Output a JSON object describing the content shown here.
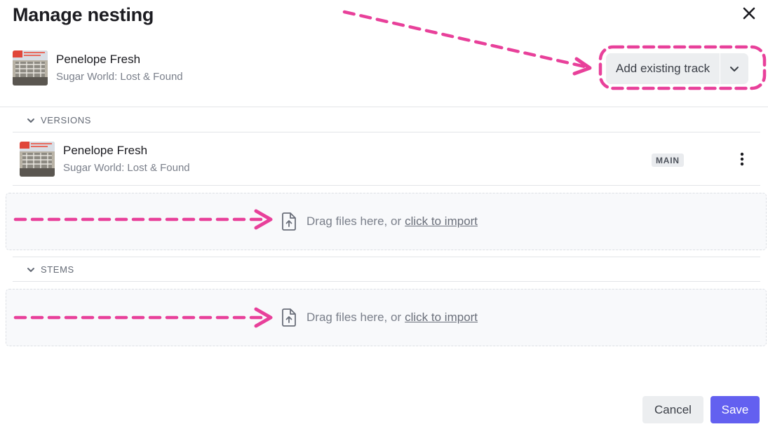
{
  "dialog": {
    "title": "Manage nesting"
  },
  "parent_track": {
    "title": "Penelope Fresh",
    "album": "Sugar World: Lost & Found"
  },
  "add_existing": {
    "label": "Add existing track"
  },
  "versions": {
    "header": "VERSIONS",
    "items": [
      {
        "title": "Penelope Fresh",
        "album": "Sugar World: Lost & Found",
        "badge": "MAIN"
      }
    ],
    "dropzone": {
      "text": "Drag files here, or",
      "link": "click to import"
    }
  },
  "stems": {
    "header": "STEMS",
    "dropzone": {
      "text": "Drag files here, or",
      "link": "click to import"
    }
  },
  "footer": {
    "cancel_label": "Cancel",
    "save_label": "Save"
  },
  "colors": {
    "accent": "#6360f0",
    "annotation": "#e8409a"
  },
  "icons": [
    "close-icon",
    "chevron-down-icon",
    "more-vertical-icon",
    "file-upload-icon",
    "album-art"
  ]
}
